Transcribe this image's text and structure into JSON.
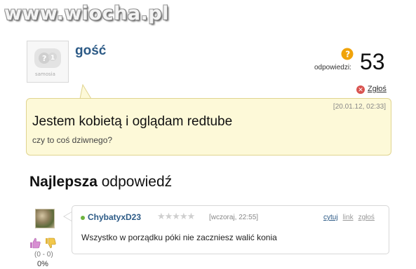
{
  "watermark": "www.wiocha.pl",
  "question": {
    "username": "gość",
    "avatar_text": "samosia",
    "answers_label": "odpowiedzi:",
    "answers_count": "53",
    "report_label": "Zgłoś",
    "date": "[20.01.12, 02:33]",
    "title": "Jestem kobietą i oglądam redtube",
    "subtitle": "czy to coś dziwnego?"
  },
  "best_answer": {
    "heading_bold": "Najlepsza",
    "heading_rest": " odpowiedź",
    "username": "ChybatyxD23",
    "stars": "★★★★★",
    "rating_stars_filled": 0,
    "date": "[wczoraj, 22:55]",
    "actions": {
      "quote": "cytuj",
      "link": "link",
      "report": "zgłoś"
    },
    "text": "Wszystko w porządku póki nie zaczniesz walić konia",
    "votes": "(0 - 0)",
    "percent": "0%"
  },
  "colors": {
    "accent": "#2c5a86",
    "question_bg": "#fdf9d8",
    "question_border": "#e0d48f",
    "warning": "#f0a30a"
  }
}
